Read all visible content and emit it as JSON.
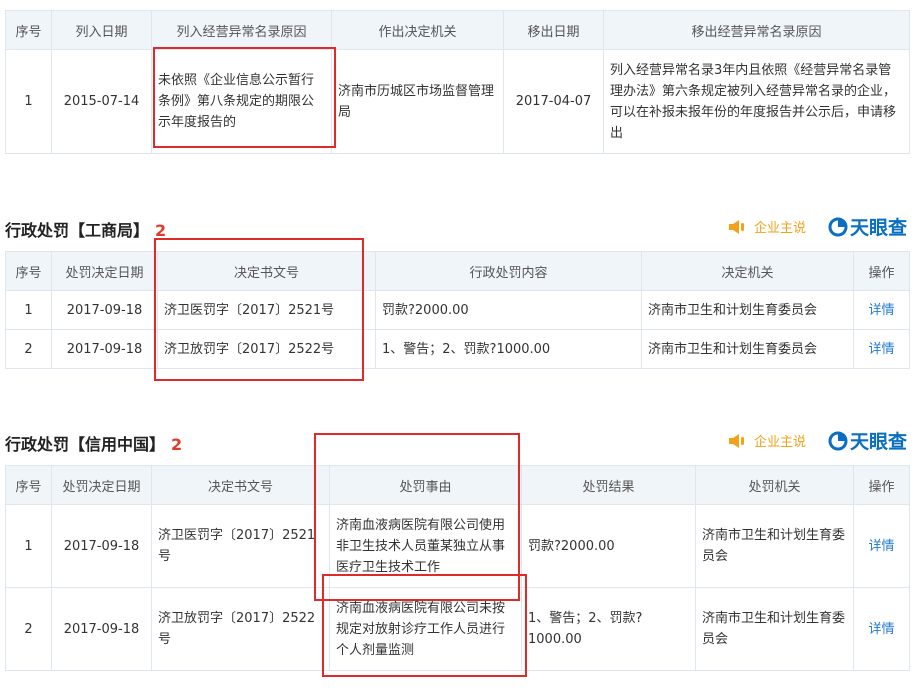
{
  "abnormal": {
    "headers": [
      "序号",
      "列入日期",
      "列入经营异常名录原因",
      "作出决定机关",
      "移出日期",
      "移出经营异常名录原因"
    ],
    "rows": [
      {
        "no": "1",
        "date": "2015-07-14",
        "reason": "未依照《企业信息公示暂行条例》第八条规定的期限公示年度报告的",
        "authority": "济南市历城区市场监督管理局",
        "remove_date": "2017-04-07",
        "remove_reason": "列入经营异常名录3年内且依照《经营异常名录管理办法》第六条规定被列入经营异常名录的企业，可以在补报未报年份的年度报告并公示后，申请移出"
      }
    ]
  },
  "penalty_gsj": {
    "title": "行政处罚【工商局】",
    "count": "2",
    "headers": [
      "序号",
      "处罚决定日期",
      "决定书文号",
      "行政处罚内容",
      "决定机关",
      "操作"
    ],
    "rows": [
      {
        "no": "1",
        "date": "2017-09-18",
        "doc": "济卫医罚字〔2017〕2521号",
        "content": "罚款?2000.00",
        "authority": "济南市卫生和计划生育委员会",
        "action": "详情"
      },
      {
        "no": "2",
        "date": "2017-09-18",
        "doc": "济卫放罚字〔2017〕2522号",
        "content": "1、警告；2、罚款?1000.00",
        "authority": "济南市卫生和计划生育委员会",
        "action": "详情"
      }
    ]
  },
  "penalty_xyzg": {
    "title": "行政处罚【信用中国】",
    "count": "2",
    "headers": [
      "序号",
      "处罚决定日期",
      "决定书文号",
      "处罚事由",
      "处罚结果",
      "处罚机关",
      "操作"
    ],
    "rows": [
      {
        "no": "1",
        "date": "2017-09-18",
        "doc": "济卫医罚字〔2017〕2521号",
        "reason": "济南血液病医院有限公司使用非卫生技术人员董某独立从事医疗卫生技术工作",
        "result": "罚款?2000.00",
        "authority": "济南市卫生和计划生育委员会",
        "action": "详情"
      },
      {
        "no": "2",
        "date": "2017-09-18",
        "doc": "济卫放罚字〔2017〕2522号",
        "reason": "济南血液病医院有限公司未按规定对放射诊疗工作人员进行个人剂量监测",
        "result": "1、警告；2、罚款?1000.00",
        "authority": "济南市卫生和计划生育委员会",
        "action": "详情"
      }
    ]
  },
  "brand": {
    "qyzs": "企业主说",
    "tyc": "天眼查"
  },
  "colors": {
    "accent": "#1f7ad0",
    "count_red": "#e03a2c",
    "header_bg": "#f0f5fa",
    "brand_orange": "#f2a21a",
    "highlight_box": "#e02a2a"
  },
  "icons": [
    "speaker-icon",
    "tianyancha-logo-icon"
  ]
}
